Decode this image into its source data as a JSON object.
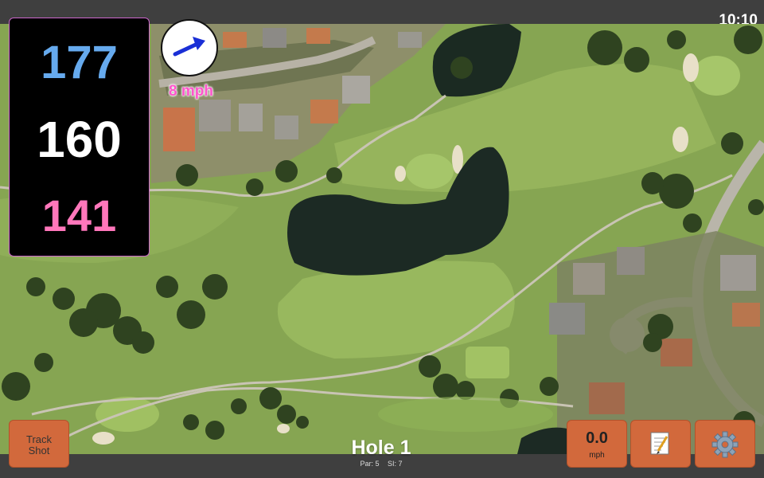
{
  "status_bar": {
    "time": "10:10"
  },
  "distances": {
    "back": "177",
    "middle": "160",
    "front": "141",
    "back_color": "#66aaee",
    "middle_color": "#ffffff",
    "front_color": "#ff77bb"
  },
  "wind": {
    "speed": "8 mph",
    "direction_icon": "wind-arrow-icon"
  },
  "buttons": {
    "track_shot_line1": "Track",
    "track_shot_line2": "Shot",
    "speed_value": "0.0",
    "speed_unit": "mph",
    "notes_icon": "notepad-icon",
    "settings_icon": "gear-icon",
    "accent_color": "#d2693c"
  },
  "hole": {
    "title": "Hole 1",
    "par": "Par: 5",
    "stroke_index": "SI: 7"
  }
}
